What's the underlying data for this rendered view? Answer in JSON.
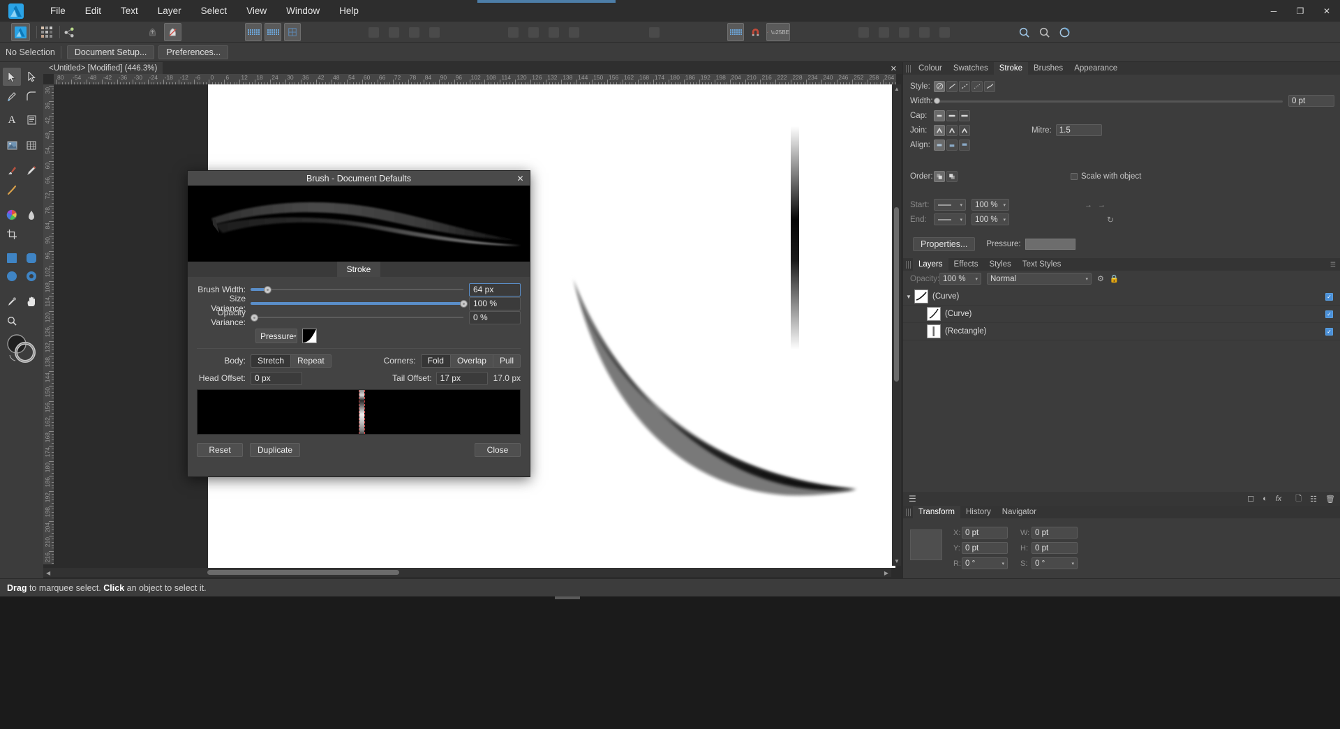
{
  "app": {
    "logo_icon": "affinity-designer-logo",
    "menus": [
      "File",
      "Edit",
      "Text",
      "Layer",
      "Select",
      "View",
      "Window",
      "Help"
    ],
    "window_controls": {
      "minimize": "─",
      "maximize": "❐",
      "close": "✕"
    }
  },
  "toolbar": {
    "items": [
      {
        "name": "persona-designer",
        "icon": "affinity-designer-persona-icon"
      },
      {
        "name": "persona-pixel",
        "icon": "pixel-persona-icon"
      },
      {
        "name": "persona-export",
        "icon": "export-persona-icon"
      },
      {
        "name": "move-front",
        "icon": "bring-to-front-icon"
      },
      {
        "name": "move-back",
        "icon": "send-to-back-icon"
      },
      {
        "name": "show-grid",
        "icon": "grid-icon"
      },
      {
        "name": "snapping",
        "icon": "snapping-icon"
      },
      {
        "name": "pixel-preview",
        "icon": "pixel-preview-icon"
      },
      {
        "name": "align-left",
        "icon": "align-left-icon"
      },
      {
        "name": "align-centre",
        "icon": "align-centre-icon"
      },
      {
        "name": "align-right",
        "icon": "align-right-icon"
      },
      {
        "name": "align-justify",
        "icon": "align-justify-icon"
      },
      {
        "name": "distribute-1",
        "icon": "distribute-horizontal-icon"
      },
      {
        "name": "distribute-2",
        "icon": "distribute-vertical-icon"
      },
      {
        "name": "distribute-3",
        "icon": "distribute-space-icon"
      },
      {
        "name": "distribute-4",
        "icon": "distribute-even-icon"
      },
      {
        "name": "geometry-add",
        "icon": "boolean-add-icon"
      },
      {
        "name": "grid-view",
        "icon": "blue-grid-icon"
      },
      {
        "name": "snap-toggle",
        "icon": "magnet-icon"
      },
      {
        "name": "brush-select",
        "icon": "brush-icon"
      },
      {
        "name": "zoom-fit",
        "icon": "zoom-fit-icon"
      },
      {
        "name": "zoom-actual",
        "icon": "zoom-actual-icon"
      },
      {
        "name": "rotate-view",
        "icon": "rotate-view-icon"
      }
    ]
  },
  "context_bar": {
    "selection_label": "No Selection",
    "document_setup_label": "Document Setup...",
    "preferences_label": "Preferences..."
  },
  "document": {
    "tab_title": "<Untitled> [Modified] (446.3%)",
    "close_icon": "close-icon",
    "zoom_percent": "446.3%"
  },
  "rulers": {
    "horizontal_ticks": [
      "80",
      "-54",
      "-48",
      "-42",
      "-36",
      "-30",
      "-24",
      "-18",
      "-12",
      "-6",
      "0",
      "6",
      "12",
      "18",
      "24",
      "30",
      "36",
      "42",
      "48",
      "54",
      "60",
      "66",
      "72",
      "78",
      "84",
      "90",
      "96",
      "102",
      "108",
      "114",
      "120",
      "126",
      "132",
      "138",
      "144",
      "150",
      "156",
      "162",
      "168",
      "174",
      "180",
      "186",
      "192",
      "198",
      "204",
      "210",
      "216",
      "222",
      "228",
      "234",
      "240",
      "246",
      "252",
      "258",
      "264"
    ],
    "vertical_ticks": [
      "30",
      "36",
      "42",
      "48",
      "54",
      "60",
      "66",
      "72",
      "78",
      "84",
      "90",
      "96",
      "102",
      "108",
      "114",
      "120",
      "126",
      "132",
      "138",
      "144",
      "150",
      "156",
      "162",
      "168",
      "174",
      "180",
      "186",
      "192",
      "198",
      "204",
      "210",
      "216"
    ]
  },
  "right_panel": {
    "tabs_top": [
      {
        "label": "Colour",
        "active": false
      },
      {
        "label": "Swatches",
        "active": false
      },
      {
        "label": "Stroke",
        "active": true
      },
      {
        "label": "Brushes",
        "active": false
      },
      {
        "label": "Appearance",
        "active": false
      }
    ],
    "stroke": {
      "style_label": "Style:",
      "style_options": [
        "none-icon",
        "solid-line-icon",
        "dashed-line-icon",
        "dotted-line-icon",
        "texture-line-icon"
      ],
      "width_label": "Width:",
      "width_value": "0 pt",
      "cap_label": "Cap:",
      "cap_options": [
        "butt-cap-icon",
        "round-cap-icon",
        "square-cap-icon"
      ],
      "join_label": "Join:",
      "join_options": [
        "mitre-join-icon",
        "round-join-icon",
        "bevel-join-icon"
      ],
      "mitre_label": "Mitre:",
      "mitre_value": "1.5",
      "align_label": "Align:",
      "align_options": [
        "align-centre-stroke-icon",
        "align-inside-stroke-icon",
        "align-outside-stroke-icon"
      ],
      "order_label": "Order:",
      "order_options": [
        "stroke-behind-icon",
        "stroke-front-icon"
      ],
      "scale_with_object_label": "Scale with object",
      "scale_with_object_checked": false,
      "start_label": "Start:",
      "start_arrow": "no-arrow-line",
      "start_percent": "100 %",
      "end_label": "End:",
      "end_arrow": "no-arrow-line",
      "end_percent": "100 %",
      "swap_icon": "swap-arrows-icon",
      "reset_icon": "reset-arrows-icon",
      "properties_label": "Properties...",
      "pressure_label": "Pressure:"
    },
    "tabs_mid": [
      {
        "label": "Layers",
        "active": true
      },
      {
        "label": "Effects",
        "active": false
      },
      {
        "label": "Styles",
        "active": false
      },
      {
        "label": "Text Styles",
        "active": false
      }
    ],
    "layers_header": {
      "opacity_label": "Opacity:",
      "opacity_value": "100 %",
      "blend_mode": "Normal",
      "gear_icon": "gear-icon",
      "lock_icon": "lock-icon"
    },
    "layers": [
      {
        "name": "(Curve)",
        "indent": 0,
        "expanded": true,
        "visible": true,
        "thumb": "curve-thumb"
      },
      {
        "name": "(Curve)",
        "indent": 1,
        "expanded": false,
        "visible": true,
        "thumb": "curve-thumb"
      },
      {
        "name": "(Rectangle)",
        "indent": 1,
        "expanded": false,
        "visible": true,
        "thumb": "rectangle-thumb"
      }
    ],
    "layers_footer_icons": [
      "layers-stack-icon",
      "mask-icon",
      "adjustment-icon",
      "fx-icon",
      "new-layer-icon",
      "new-group-icon",
      "delete-icon"
    ],
    "tabs_bottom": [
      {
        "label": "Transform",
        "active": true
      },
      {
        "label": "History",
        "active": false
      },
      {
        "label": "Navigator",
        "active": false
      }
    ],
    "transform": {
      "x_label": "X:",
      "x_value": "0 pt",
      "y_label": "Y:",
      "y_value": "0 pt",
      "w_label": "W:",
      "w_value": "0 pt",
      "h_label": "H:",
      "h_value": "0 pt",
      "r_label": "R:",
      "r_value": "0 °",
      "s_label": "S:",
      "s_value": "0 °"
    }
  },
  "brush_dialog": {
    "title": "Brush - Document Defaults",
    "close_icon": "close-icon",
    "tabs": [
      {
        "label": "Stroke",
        "active": true
      }
    ],
    "brush_width": {
      "label": "Brush Width:",
      "value": "64 px",
      "fill_percent": 8
    },
    "size_variance": {
      "label": "Size Variance:",
      "value": "100 %",
      "fill_percent": 100
    },
    "opacity_variance": {
      "label": "Opacity Variance:",
      "value": "0 %",
      "fill_percent": 0
    },
    "dynamics": {
      "source": "Pressure",
      "dropdown_icon": "chevron-down-icon",
      "ramp_icon": "ramp-curve-icon"
    },
    "body": {
      "label": "Body:",
      "options": [
        "Stretch",
        "Repeat"
      ],
      "selected": "Stretch"
    },
    "corners": {
      "label": "Corners:",
      "options": [
        "Fold",
        "Overlap",
        "Pull"
      ],
      "selected": "Fold"
    },
    "head_offset": {
      "label": "Head Offset:",
      "value": "0 px"
    },
    "tail_offset": {
      "label": "Tail Offset:",
      "value": "17 px",
      "total": "17.0 px"
    },
    "buttons": {
      "reset": "Reset",
      "duplicate": "Duplicate",
      "close": "Close"
    }
  },
  "status_bar": {
    "text_drag": "Drag",
    "text_mid": " to marquee select. ",
    "text_click": "Click",
    "text_end": " an object to select it."
  },
  "colors": {
    "accent_blue": "#5a8ec9",
    "panel_bg": "#3c3c3c",
    "dialog_bg": "#434343",
    "canvas_bg": "#2b2b2b",
    "page_white": "#ffffff",
    "checkbox_blue": "#4a90d9"
  }
}
